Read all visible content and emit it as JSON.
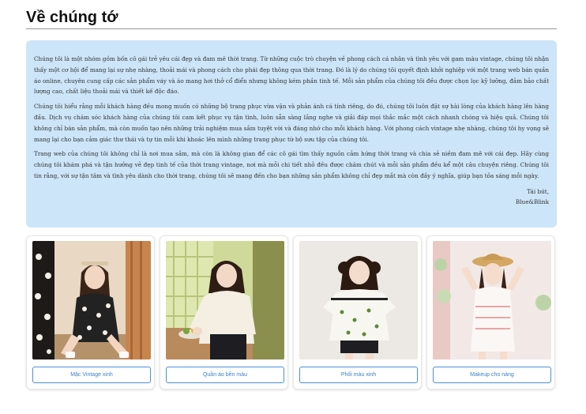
{
  "page": {
    "title": "Về chúng tớ"
  },
  "about": {
    "paragraphs": [
      "Chúng tôi là một nhóm gồm bốn cô gái trẻ yêu cái đẹp và đam mê thời trang. Từ những cuộc trò chuyện về phong cách cá nhân và tình yêu với gam màu vintage, chúng tôi nhận thấy một cơ hội để mang lại sự nhẹ nhàng, thoải mái và phong cách cho phái đẹp thông qua thời trang. Đó là lý do chúng tôi quyết định khởi nghiệp với một trang web bán quần áo online, chuyên cung cấp các sản phẩm váy và áo mang hơi thở cổ điển nhưng không kém phần tinh tế. Mỗi sản phẩm của chúng tôi đều được chọn lọc kỹ lưỡng, đảm bảo chất lượng cao, chất liệu thoải mái và thiết kế độc đáo.",
      "Chúng tôi hiểu rằng mỗi khách hàng đều mong muốn có những bộ trang phục vừa vặn và phản ánh cá tính riêng, do đó, chúng tôi luôn đặt sự hài lòng của khách hàng lên hàng đầu. Dịch vụ chăm sóc khách hàng của chúng tôi cam kết phục vụ tận tình, luôn sẵn sàng lắng nghe và giải đáp mọi thắc mắc một cách nhanh chóng và hiệu quả. Chúng tôi không chỉ bán sản phẩm, mà còn muốn tạo nên những trải nghiệm mua sắm tuyệt vời và đáng nhớ cho mỗi khách hàng. Với phong cách vintage nhẹ nhàng, chúng tôi hy vọng sẽ mang lại cho bạn cảm giác thư thái và tự tin mỗi khi khoác lên mình những trang phục từ bộ sưu tập của chúng tôi.",
      "Trang web của chúng tôi không chỉ là nơi mua sắm, mà còn là không gian để các cô gái tìm thấy nguồn cảm hứng thời trang và chia sẻ niềm đam mê với cái đẹp. Hãy cùng chúng tôi khám phá và tận hưởng vẻ đẹp tinh tế của thời trang vintage, nơi mà mỗi chi tiết nhỏ đều được chăm chút và mỗi sản phẩm đều kể một câu chuyện riêng. Chúng tôi tin rằng, với sự tận tâm và tình yêu dành cho thời trang, chúng tôi sẽ mang đến cho bạn những sản phẩm không chỉ đẹp mắt mà còn đầy ý nghĩa, giúp bạn tỏa sáng mỗi ngày."
    ],
    "signoff": "Tái bút,",
    "signature": "Blue&Blink",
    "background_color": "#cde5f8"
  },
  "gallery": {
    "cards": [
      {
        "button_label": "Mặc Vintage xinh",
        "photo_icon": "model-photo"
      },
      {
        "button_label": "Quần áo bền màu",
        "photo_icon": "model-photo"
      },
      {
        "button_label": "Phối màu xinh",
        "photo_icon": "model-photo"
      },
      {
        "button_label": "Makeup cho nàng",
        "photo_icon": "model-photo"
      }
    ],
    "accent_color": "#4a90d9"
  }
}
